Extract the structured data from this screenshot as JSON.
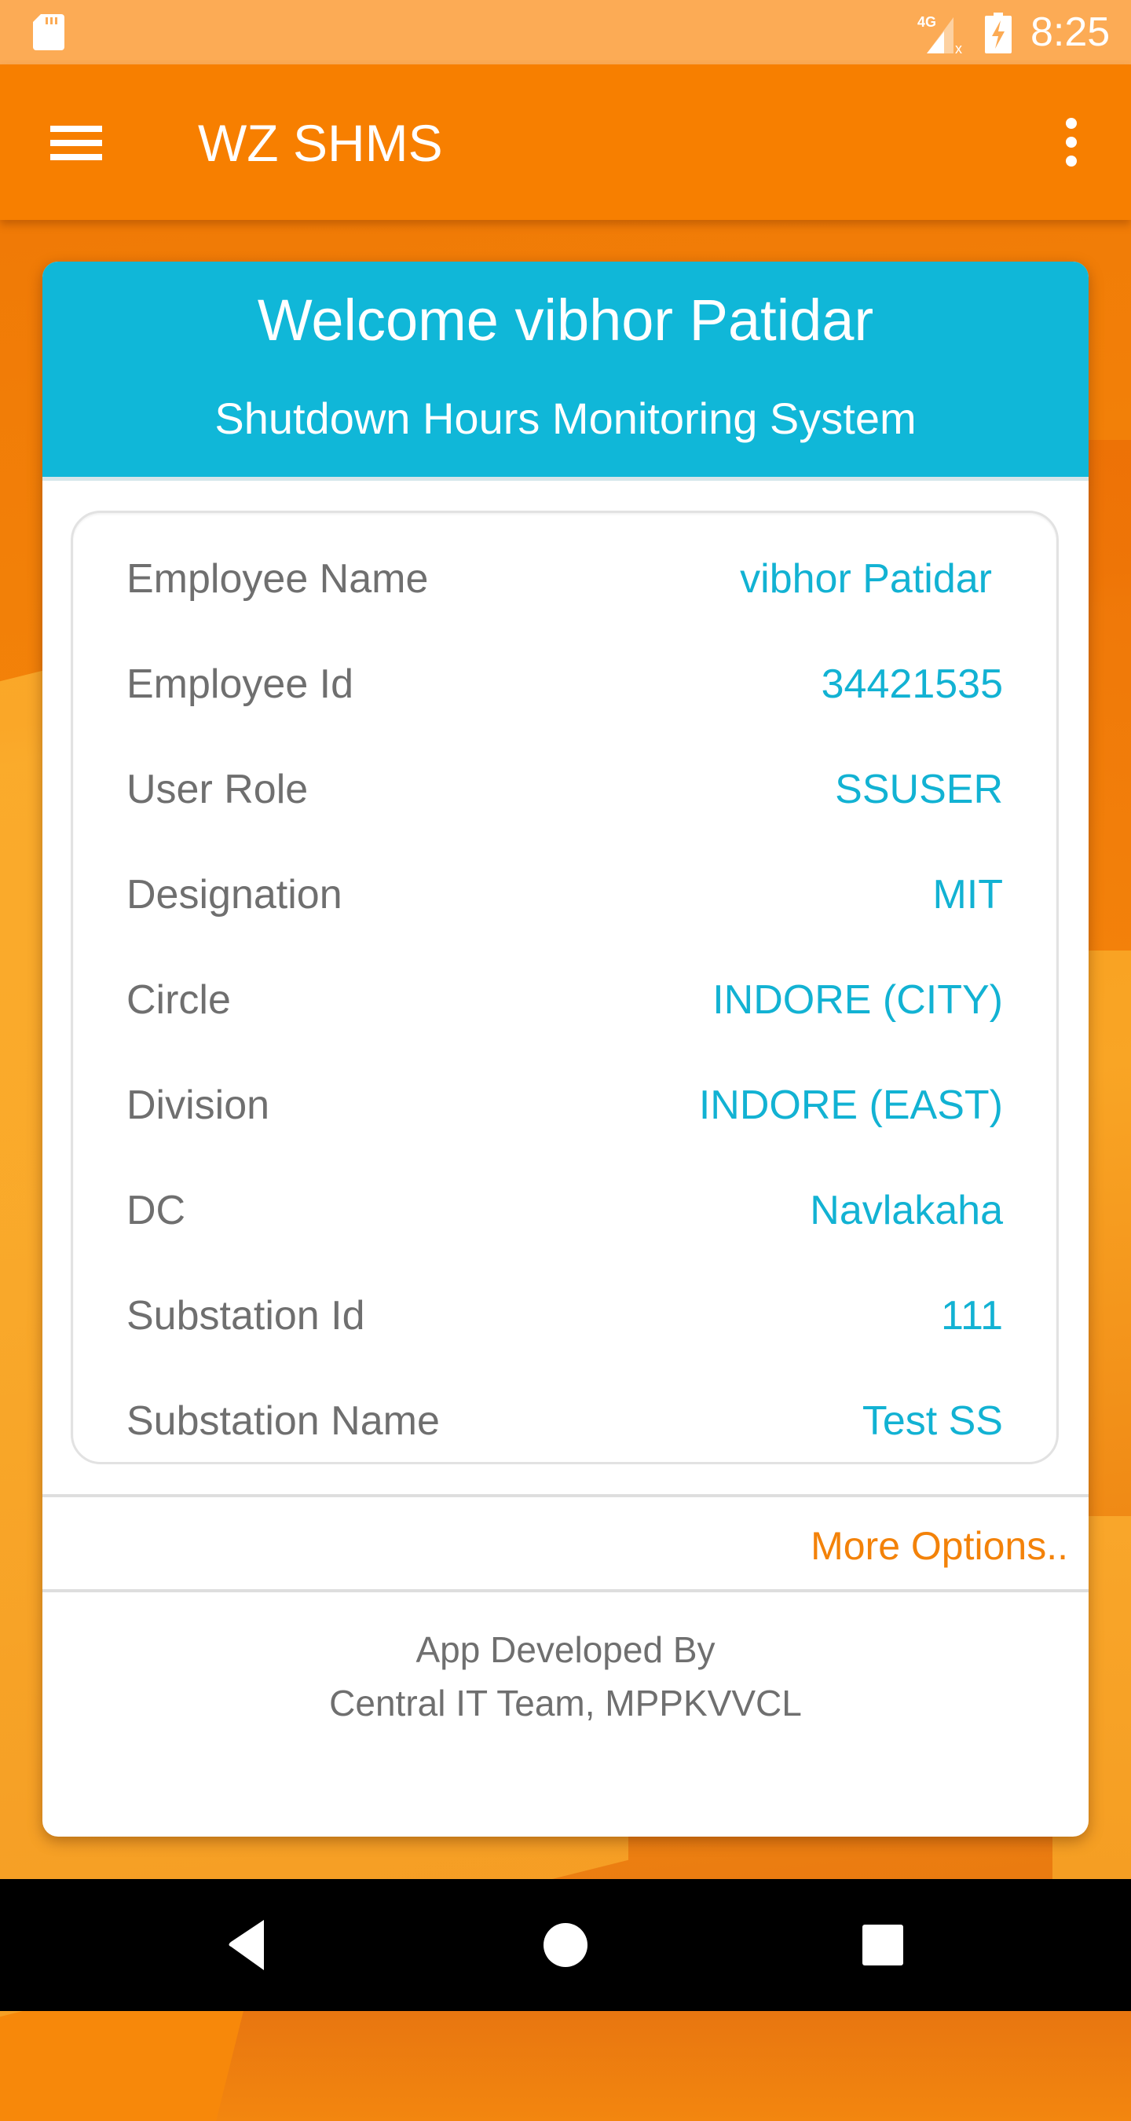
{
  "status_bar": {
    "time": "8:25",
    "network_label": "4G",
    "icons": [
      "sd-card-icon",
      "signal-4g-no-data-icon",
      "battery-charging-icon"
    ]
  },
  "app_bar": {
    "title": "WZ SHMS",
    "menu_icon": "hamburger-menu-icon",
    "overflow_icon": "more-vert-icon"
  },
  "card": {
    "welcome": "Welcome vibhor Patidar",
    "subtitle": "Shutdown Hours Monitoring System",
    "rows": [
      {
        "label": "Employee Name",
        "value": "vibhor Patidar"
      },
      {
        "label": "Employee Id",
        "value": "34421535"
      },
      {
        "label": "User Role",
        "value": "SSUSER"
      },
      {
        "label": "Designation",
        "value": "MIT"
      },
      {
        "label": "Circle",
        "value": "INDORE (CITY)"
      },
      {
        "label": "Division",
        "value": "INDORE (EAST)"
      },
      {
        "label": "DC",
        "value": "Navlakaha"
      },
      {
        "label": "Substation Id",
        "value": "111"
      },
      {
        "label": "Substation Name",
        "value": "Test SS"
      }
    ],
    "more_options": "More Options..",
    "footer_line1": "App Developed By",
    "footer_line2": "Central IT Team, MPPKVVCL"
  },
  "nav_bar": {
    "back_icon": "back-triangle-icon",
    "home_icon": "home-circle-icon",
    "recents_icon": "recents-square-icon"
  },
  "colors": {
    "app_bar": "#f77f00",
    "status_bar": "#fcab55",
    "header_accent": "#10b7d8",
    "value_text": "#12b2d3",
    "label_text": "#6f6f6f",
    "link": "#f38209"
  }
}
